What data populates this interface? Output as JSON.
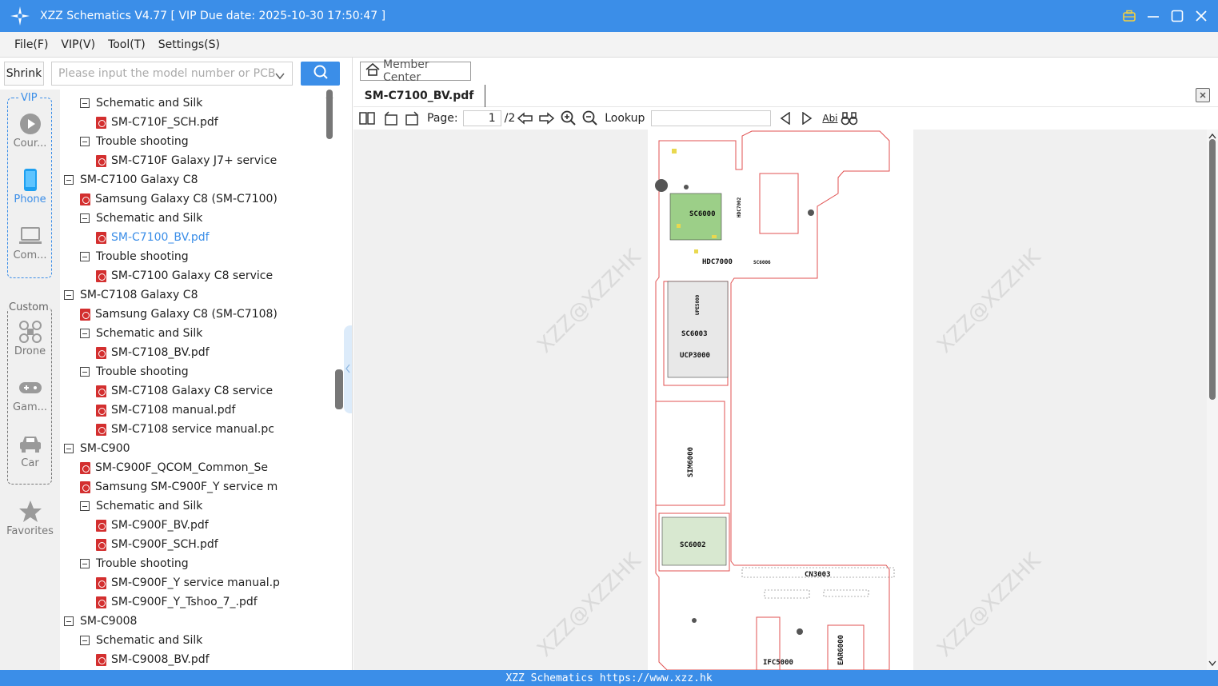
{
  "window": {
    "title": "XZZ Schematics V4.77 [ VIP Due date: 2025-10-30 17:50:47 ]"
  },
  "menu": [
    "File(F)",
    "VIP(V)",
    "Tool(T)",
    "Settings(S)"
  ],
  "search": {
    "shrink_label": "Shrink",
    "placeholder": "Please input the model number or PCB"
  },
  "rail": {
    "vip_label": "VIP",
    "custom_label": "Custom",
    "vip_items": [
      "Cour...",
      "Phone",
      "Com..."
    ],
    "custom_items": [
      "Drone",
      "Gam...",
      "Car"
    ],
    "favorites": "Favorites"
  },
  "tree": [
    {
      "level": 1,
      "type": "folder",
      "label": "Schematic and Silk"
    },
    {
      "level": 2,
      "type": "pdf",
      "label": "SM-C710F_SCH.pdf"
    },
    {
      "level": 1,
      "type": "folder",
      "label": "Trouble shooting"
    },
    {
      "level": 2,
      "type": "pdf",
      "label": "SM-C710F Galaxy J7+ service"
    },
    {
      "level": 0,
      "type": "folder",
      "label": "SM-C7100 Galaxy C8"
    },
    {
      "level": 1,
      "type": "pdf",
      "label": "Samsung Galaxy C8 (SM-C7100)"
    },
    {
      "level": 1,
      "type": "folder",
      "label": "Schematic and Silk"
    },
    {
      "level": 2,
      "type": "pdf",
      "label": "SM-C7100_BV.pdf",
      "selected": true
    },
    {
      "level": 1,
      "type": "folder",
      "label": "Trouble shooting"
    },
    {
      "level": 2,
      "type": "pdf",
      "label": "SM-C7100 Galaxy C8 service"
    },
    {
      "level": 0,
      "type": "folder",
      "label": "SM-C7108 Galaxy C8"
    },
    {
      "level": 1,
      "type": "pdf",
      "label": "Samsung Galaxy C8 (SM-C7108)"
    },
    {
      "level": 1,
      "type": "folder",
      "label": "Schematic and Silk"
    },
    {
      "level": 2,
      "type": "pdf",
      "label": "SM-C7108_BV.pdf"
    },
    {
      "level": 1,
      "type": "folder",
      "label": "Trouble shooting"
    },
    {
      "level": 2,
      "type": "pdf",
      "label": "SM-C7108 Galaxy C8 service"
    },
    {
      "level": 2,
      "type": "pdf",
      "label": "SM-C7108 manual.pdf"
    },
    {
      "level": 2,
      "type": "pdf",
      "label": "SM-C7108 service manual.pc"
    },
    {
      "level": 0,
      "type": "folder",
      "label": "SM-C900"
    },
    {
      "level": 1,
      "type": "pdf",
      "label": "SM-C900F_QCOM_Common_Se"
    },
    {
      "level": 1,
      "type": "pdf",
      "label": "Samsung SM-C900F_Y service m"
    },
    {
      "level": 1,
      "type": "folder",
      "label": "Schematic and Silk"
    },
    {
      "level": 2,
      "type": "pdf",
      "label": "SM-C900F_BV.pdf"
    },
    {
      "level": 2,
      "type": "pdf",
      "label": "SM-C900F_SCH.pdf"
    },
    {
      "level": 1,
      "type": "folder",
      "label": "Trouble shooting"
    },
    {
      "level": 2,
      "type": "pdf",
      "label": "SM-C900F_Y service manual.p"
    },
    {
      "level": 2,
      "type": "pdf",
      "label": "SM-C900F_Y_Tshoo_7_.pdf"
    },
    {
      "level": 0,
      "type": "folder",
      "label": "SM-C9008"
    },
    {
      "level": 1,
      "type": "folder",
      "label": "Schematic and Silk"
    },
    {
      "level": 2,
      "type": "pdf",
      "label": "SM-C9008_BV.pdf"
    }
  ],
  "viewer": {
    "member_center": "Member Center",
    "tab": "SM-C7100_BV.pdf",
    "page_label": "Page:",
    "page_current": "1",
    "page_total": "/2",
    "lookup_label": "Lookup",
    "abi": "Abi",
    "watermark": "XZZ@XZZHK",
    "board_labels": [
      "SC6000",
      "HDC7000",
      "SC6003",
      "UCP3000",
      "SIM6000",
      "SC6002",
      "CN3003",
      "IFC5000",
      "EAR6000",
      "UPE5000",
      "HDC7002",
      "SC6006"
    ]
  },
  "status": "XZZ Schematics https://www.xzz.hk",
  "colors": {
    "accent": "#3b8ee8",
    "pdf": "#d32f2f",
    "selected": "#3b8ee8"
  }
}
